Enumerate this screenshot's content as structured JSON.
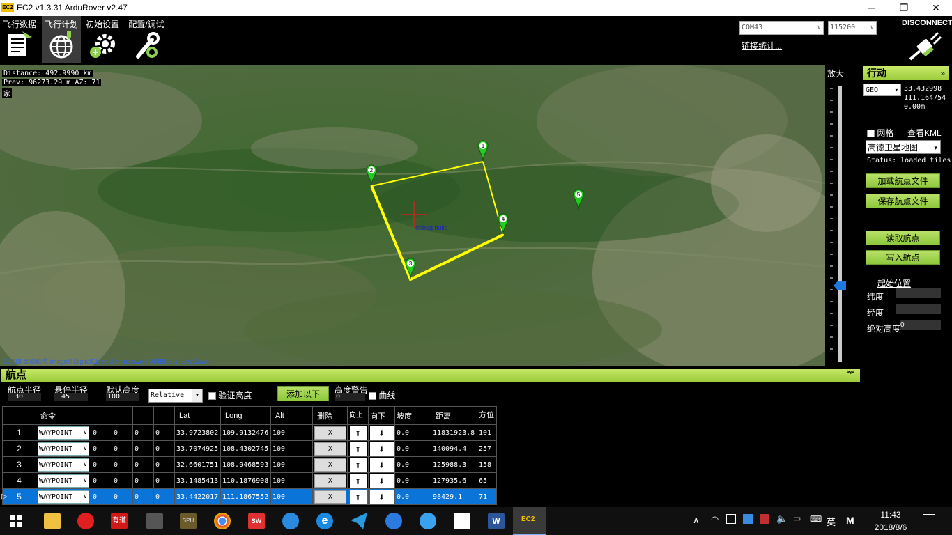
{
  "window": {
    "title": "EC2 v1.3.31 ArduRover v2.47",
    "logo_text": "EC2"
  },
  "nav": [
    {
      "label": "飞行数据",
      "icon": "flight-data-icon"
    },
    {
      "label": "飞行计划",
      "icon": "globe-icon"
    },
    {
      "label": "初始设置",
      "icon": "initial-setup-icon"
    },
    {
      "label": "配置/调试",
      "icon": "config-tuning-icon"
    }
  ],
  "connection": {
    "port": "COM43",
    "baud": "115200",
    "link_stats": "链接统计...",
    "disconnect": "DISCONNECT"
  },
  "map": {
    "distance": "Distance: 492.9990 km",
    "prev": "Prev: 96273.29 m AZ: 71",
    "home": "家",
    "debug": "debug build",
    "copyright": "©2018 高德软件 Image© DigitalGlobe & chinasiwei | AIRBUS & EastDawn",
    "markers": [
      "1",
      "2",
      "3",
      "4",
      "5"
    ]
  },
  "zoom": {
    "label": "放大"
  },
  "right_panel": {
    "title": "行动",
    "coord_system": "GEO",
    "lat": "33.432998",
    "lng": "111.164754",
    "alt": "0.00m",
    "grid_label": "网格",
    "view_kml": "查看KML",
    "map_type": "高德卫星地图",
    "status": "Status: loaded tiles",
    "load_wp": "加载航点文件",
    "save_wp": "保存航点文件",
    "dots": "...",
    "read_wp": "读取航点",
    "write_wp": "写入航点",
    "home_location": "起始位置",
    "home_lat_label": "纬度",
    "home_lng_label": "经度",
    "home_alt_label": "绝对高度",
    "home_alt_value": "0"
  },
  "waypoints_panel": {
    "title": "航点",
    "wp_radius_label": "航点半径",
    "wp_radius": "30",
    "loiter_radius_label": "悬停半径",
    "loiter_radius": "45",
    "default_alt_label": "默认高度",
    "default_alt": "100",
    "alt_frame": "Relative",
    "verify_height": "验证高度",
    "add_below": "添加以下",
    "alt_warning_label": "高度警告",
    "alt_warning": "0",
    "spline": "曲线",
    "columns": [
      "命令",
      "",
      "",
      "",
      "",
      "Lat",
      "Long",
      "Alt",
      "删除",
      "向上",
      "向下",
      "坡度",
      "距离",
      "方位"
    ],
    "rows": [
      {
        "no": "1",
        "cmd": "WAYPOINT",
        "p1": "0",
        "p2": "0",
        "p3": "0",
        "p4": "0",
        "lat": "33.9723802",
        "lng": "109.9132476",
        "alt": "100",
        "del": "X",
        "grad": "0.0",
        "dist": "11831923.8",
        "az": "101"
      },
      {
        "no": "2",
        "cmd": "WAYPOINT",
        "p1": "0",
        "p2": "0",
        "p3": "0",
        "p4": "0",
        "lat": "33.7074925",
        "lng": "108.4302745",
        "alt": "100",
        "del": "X",
        "grad": "0.0",
        "dist": "140094.4",
        "az": "257"
      },
      {
        "no": "3",
        "cmd": "WAYPOINT",
        "p1": "0",
        "p2": "0",
        "p3": "0",
        "p4": "0",
        "lat": "32.6601751",
        "lng": "108.9468593",
        "alt": "100",
        "del": "X",
        "grad": "0.0",
        "dist": "125988.3",
        "az": "158"
      },
      {
        "no": "4",
        "cmd": "WAYPOINT",
        "p1": "0",
        "p2": "0",
        "p3": "0",
        "p4": "0",
        "lat": "33.1485413",
        "lng": "110.1876908",
        "alt": "100",
        "del": "X",
        "grad": "0.0",
        "dist": "127935.6",
        "az": "65"
      },
      {
        "no": "5",
        "cmd": "WAYPOINT",
        "p1": "0",
        "p2": "0",
        "p3": "0",
        "p4": "0",
        "lat": "33.4422017",
        "lng": "111.1867552",
        "alt": "100",
        "del": "X",
        "grad": "0.0",
        "dist": "98429.1",
        "az": "71"
      }
    ]
  },
  "taskbar": {
    "time": "11:43",
    "date": "2018/8/6",
    "ime": "英",
    "ime2": "M"
  },
  "colors": {
    "accent_green": "#9ccc3c",
    "selected_row": "#0a74d8",
    "route": "#ffff00",
    "marker": "#22cc22"
  }
}
